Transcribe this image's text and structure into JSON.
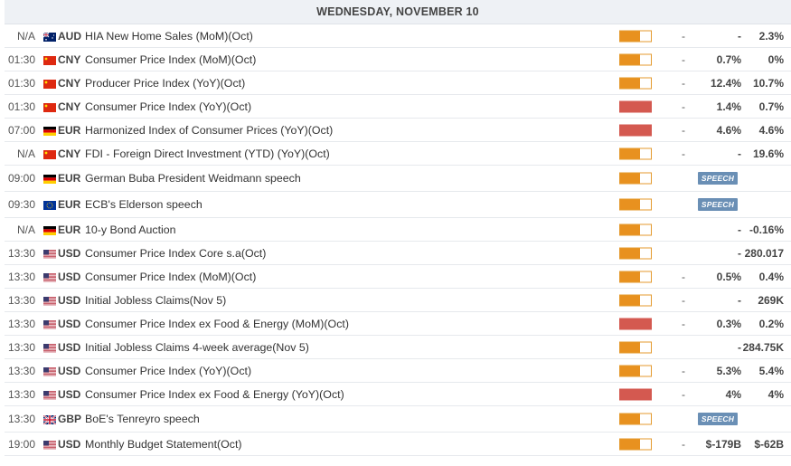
{
  "header": {
    "date": "WEDNESDAY, NOVEMBER 10"
  },
  "rows": [
    {
      "time": "N/A",
      "currency": "AUD",
      "flag": "au",
      "event": "HIA New Home Sales (MoM)(Oct)",
      "impact": "medium",
      "actual": "-",
      "consensus": "-",
      "previous": "2.3%"
    },
    {
      "time": "01:30",
      "currency": "CNY",
      "flag": "cn",
      "event": "Consumer Price Index (MoM)(Oct)",
      "impact": "medium",
      "actual": "-",
      "consensus": "0.7%",
      "previous": "0%"
    },
    {
      "time": "01:30",
      "currency": "CNY",
      "flag": "cn",
      "event": "Producer Price Index (YoY)(Oct)",
      "impact": "medium",
      "actual": "-",
      "consensus": "12.4%",
      "previous": "10.7%"
    },
    {
      "time": "01:30",
      "currency": "CNY",
      "flag": "cn",
      "event": "Consumer Price Index (YoY)(Oct)",
      "impact": "high",
      "actual": "-",
      "consensus": "1.4%",
      "previous": "0.7%"
    },
    {
      "time": "07:00",
      "currency": "EUR",
      "flag": "de",
      "event": "Harmonized Index of Consumer Prices (YoY)(Oct)",
      "impact": "high",
      "actual": "-",
      "consensus": "4.6%",
      "previous": "4.6%"
    },
    {
      "time": "N/A",
      "currency": "CNY",
      "flag": "cn",
      "event": "FDI - Foreign Direct Investment (YTD) (YoY)(Oct)",
      "impact": "medium",
      "actual": "-",
      "consensus": "-",
      "previous": "19.6%"
    },
    {
      "time": "09:00",
      "currency": "EUR",
      "flag": "de",
      "event": "German Buba President Weidmann speech",
      "impact": "medium",
      "speech": "SPEECH"
    },
    {
      "time": "09:30",
      "currency": "EUR",
      "flag": "eu",
      "event": "ECB's Elderson speech",
      "impact": "medium",
      "speech": "SPEECH"
    },
    {
      "time": "N/A",
      "currency": "EUR",
      "flag": "de",
      "event": "10-y Bond Auction",
      "impact": "medium",
      "actual": "",
      "consensus": "-",
      "previous": "-0.16%"
    },
    {
      "time": "13:30",
      "currency": "USD",
      "flag": "us",
      "event": "Consumer Price Index Core s.a(Oct)",
      "impact": "medium",
      "actual": "",
      "consensus": "-",
      "previous": "280.017"
    },
    {
      "time": "13:30",
      "currency": "USD",
      "flag": "us",
      "event": "Consumer Price Index (MoM)(Oct)",
      "impact": "medium",
      "actual": "-",
      "consensus": "0.5%",
      "previous": "0.4%"
    },
    {
      "time": "13:30",
      "currency": "USD",
      "flag": "us",
      "event": "Initial Jobless Claims(Nov 5)",
      "impact": "medium",
      "actual": "-",
      "consensus": "-",
      "previous": "269K"
    },
    {
      "time": "13:30",
      "currency": "USD",
      "flag": "us",
      "event": "Consumer Price Index ex Food & Energy (MoM)(Oct)",
      "impact": "high",
      "actual": "-",
      "consensus": "0.3%",
      "previous": "0.2%"
    },
    {
      "time": "13:30",
      "currency": "USD",
      "flag": "us",
      "event": "Initial Jobless Claims 4-week average(Nov 5)",
      "impact": "medium",
      "actual": "",
      "consensus": "-",
      "previous": "284.75K"
    },
    {
      "time": "13:30",
      "currency": "USD",
      "flag": "us",
      "event": "Consumer Price Index (YoY)(Oct)",
      "impact": "medium",
      "actual": "-",
      "consensus": "5.3%",
      "previous": "5.4%"
    },
    {
      "time": "13:30",
      "currency": "USD",
      "flag": "us",
      "event": "Consumer Price Index ex Food & Energy (YoY)(Oct)",
      "impact": "high",
      "actual": "-",
      "consensus": "4%",
      "previous": "4%"
    },
    {
      "time": "13:30",
      "currency": "GBP",
      "flag": "gb",
      "event": "BoE's Tenreyro speech",
      "impact": "medium",
      "speech": "SPEECH"
    },
    {
      "time": "19:00",
      "currency": "USD",
      "flag": "us",
      "event": "Monthly Budget Statement(Oct)",
      "impact": "medium",
      "actual": "-",
      "consensus": "$-179B",
      "previous": "$-62B"
    }
  ]
}
